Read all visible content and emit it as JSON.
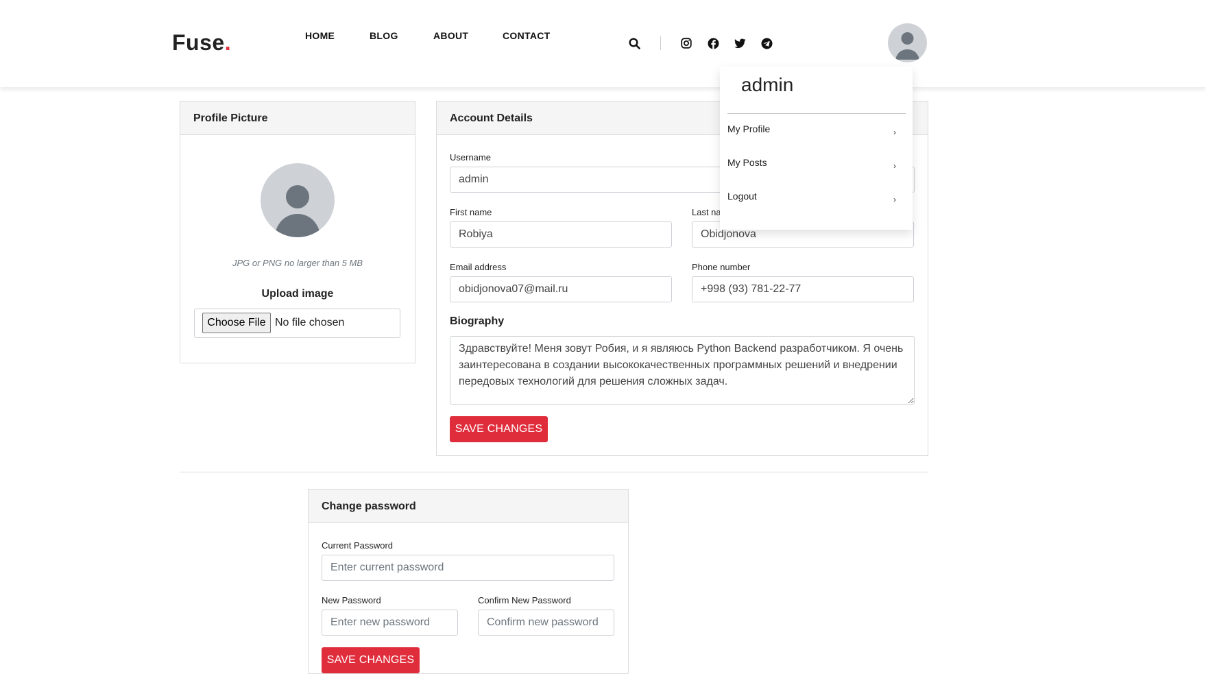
{
  "brand": {
    "name": "Fuse",
    "dot": ".",
    "dot_color": "#e02d3c"
  },
  "nav": {
    "home": "HOME",
    "blog": "BLOG",
    "about": "ABOUT",
    "contact": "CONTACT"
  },
  "header_icons": [
    "search-icon",
    "instagram-icon",
    "facebook-icon",
    "twitter-icon",
    "telegram-icon",
    "avatar"
  ],
  "profile_menu": {
    "username": "admin",
    "items": [
      {
        "label": "My Profile",
        "chevron": "›"
      },
      {
        "label": "My Posts",
        "chevron": "›"
      },
      {
        "label": "Logout",
        "chevron": "›"
      }
    ]
  },
  "profile_picture": {
    "title": "Profile Picture",
    "hint": "JPG or PNG no larger than 5 MB",
    "upload_label": "Upload image",
    "choose_file": "Choose File",
    "no_file": "No file chosen"
  },
  "account": {
    "title": "Account Details",
    "username_label": "Username",
    "username": "admin",
    "first_name_label": "First name",
    "first_name": "Robiya",
    "last_name_label": "Last na",
    "last_name": "Obidjonova",
    "email_label": "Email address",
    "email": "obidjonova07@mail.ru",
    "phone_label": "Phone number",
    "phone": "+998 (93) 781-22-77",
    "bio_label": "Biography",
    "bio": "Здравствуйте! Меня зовут Робия, и я являюсь Python Backend разработчиком. Я очень заинтересована в создании высококачественных программных решений и внедрении передовых технологий для решения сложных задач.",
    "save": "SAVE CHANGES"
  },
  "password": {
    "title": "Change password",
    "current_label": "Current Password",
    "current_placeholder": "Enter current password",
    "new_label": "New Password",
    "new_placeholder": "Enter new password",
    "confirm_label": "Confirm New Password",
    "confirm_placeholder": "Confirm new password",
    "save": "SAVE CHANGES"
  },
  "colors": {
    "accent": "#e02d3c",
    "card_header": "#f5f5f5",
    "avatar_bg": "#ced2d7",
    "avatar_fg": "#6c757d"
  }
}
